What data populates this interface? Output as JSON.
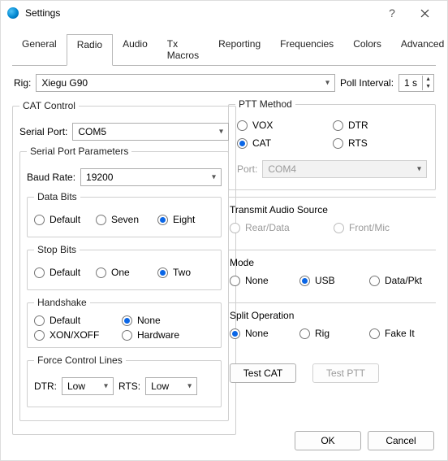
{
  "window": {
    "title": "Settings"
  },
  "tabs": [
    "General",
    "Radio",
    "Audio",
    "Tx Macros",
    "Reporting",
    "Frequencies",
    "Colors",
    "Advanced"
  ],
  "activeTab": "Radio",
  "rig": {
    "label": "Rig:",
    "value": "Xiegu G90",
    "pollLabel": "Poll Interval:",
    "pollValue": "1 s"
  },
  "cat": {
    "legend": "CAT Control",
    "serialPortLabel": "Serial Port:",
    "serialPortValue": "COM5",
    "params": {
      "legend": "Serial Port Parameters",
      "baudLabel": "Baud Rate:",
      "baudValue": "19200",
      "dataBits": {
        "legend": "Data Bits",
        "options": [
          "Default",
          "Seven",
          "Eight"
        ],
        "selected": "Eight"
      },
      "stopBits": {
        "legend": "Stop Bits",
        "options": [
          "Default",
          "One",
          "Two"
        ],
        "selected": "Two"
      },
      "handshake": {
        "legend": "Handshake",
        "options": [
          "Default",
          "None",
          "XON/XOFF",
          "Hardware"
        ],
        "selected": "None"
      },
      "force": {
        "legend": "Force Control Lines",
        "dtrLabel": "DTR:",
        "dtrValue": "Low",
        "rtsLabel": "RTS:",
        "rtsValue": "Low"
      }
    }
  },
  "ptt": {
    "legend": "PTT Method",
    "options": [
      "VOX",
      "DTR",
      "CAT",
      "RTS"
    ],
    "selected": "CAT",
    "portLabel": "Port:",
    "portValue": "COM4"
  },
  "txAudio": {
    "legend": "Transmit Audio Source",
    "options": [
      "Rear/Data",
      "Front/Mic"
    ]
  },
  "mode": {
    "legend": "Mode",
    "options": [
      "None",
      "USB",
      "Data/Pkt"
    ],
    "selected": "USB"
  },
  "split": {
    "legend": "Split Operation",
    "options": [
      "None",
      "Rig",
      "Fake It"
    ],
    "selected": "None"
  },
  "buttons": {
    "testCat": "Test CAT",
    "testPtt": "Test PTT",
    "ok": "OK",
    "cancel": "Cancel"
  }
}
